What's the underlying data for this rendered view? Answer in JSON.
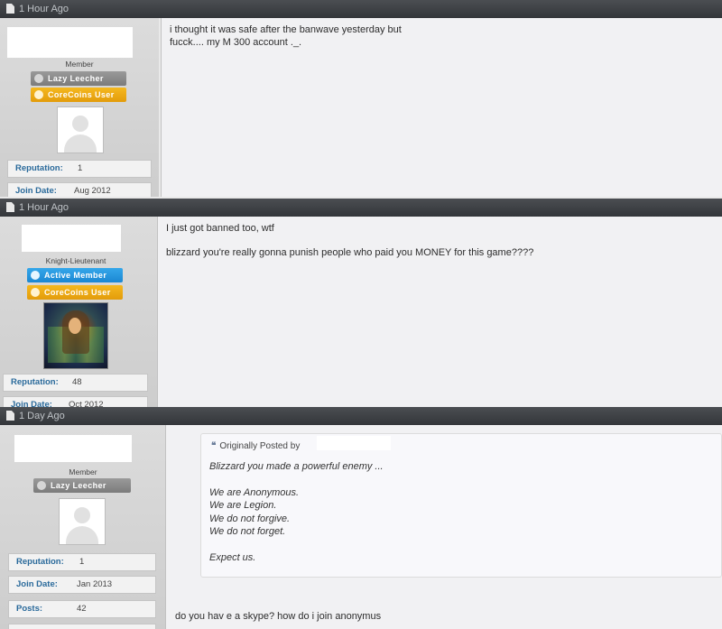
{
  "posts": [
    {
      "time": "1 Hour Ago",
      "rank": "Member",
      "badges": [
        "Lazy Leecher",
        "CoreCoins User"
      ],
      "stats": [
        {
          "label": "Reputation:",
          "value": "1"
        },
        {
          "label": "Join Date:",
          "value": "Aug 2012"
        }
      ],
      "message": "i thought it was safe after the banwave yesterday but\nfucck.... my M 300 account ._."
    },
    {
      "time": "1 Hour Ago",
      "rank": "Knight-Lieutenant",
      "badges": [
        "Active Member",
        "CoreCoins User"
      ],
      "stats": [
        {
          "label": "Reputation:",
          "value": "48"
        },
        {
          "label": "Join Date:",
          "value": "Oct 2012"
        }
      ],
      "message": "I just got banned too, wtf\n\nblizzard you're really gonna punish people who paid you MONEY for this game????"
    },
    {
      "time": "1 Day Ago",
      "rank": "Member",
      "badges": [
        "Lazy Leecher"
      ],
      "stats": [
        {
          "label": "Reputation:",
          "value": "1"
        },
        {
          "label": "Join Date:",
          "value": "Jan 2013"
        },
        {
          "label": "Posts:",
          "value": "42"
        }
      ],
      "quote": {
        "header": "Originally Posted by",
        "text": "Blizzard you made a powerful enemy ...\n\nWe are Anonymous.\nWe are Legion.\nWe do not forgive.\nWe do not forget.\n\nExpect us."
      },
      "message": "do you hav e a skype? how do i join anonymus"
    }
  ]
}
